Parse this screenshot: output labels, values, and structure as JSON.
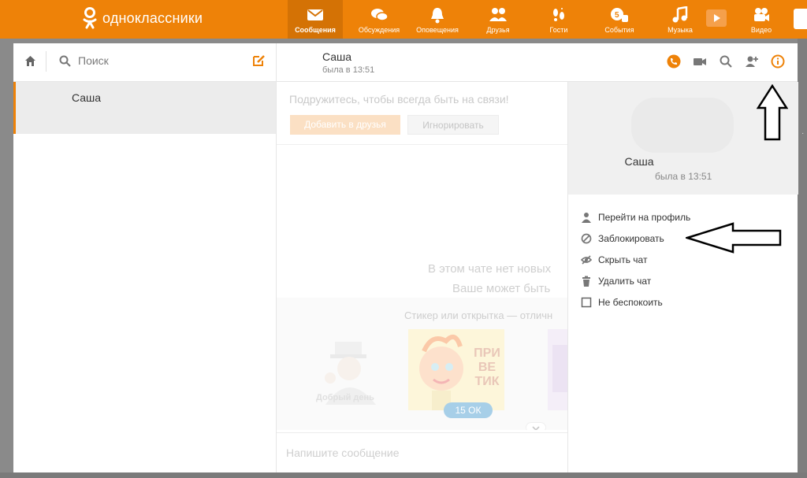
{
  "brand": {
    "name": "одноклассники"
  },
  "nav": [
    {
      "label": "Сообщения",
      "icon": "envelope-icon",
      "active": true
    },
    {
      "label": "Обсуждения",
      "icon": "chat-bubbles-icon",
      "active": false
    },
    {
      "label": "Оповещения",
      "icon": "bell-icon",
      "active": false
    },
    {
      "label": "Друзья",
      "icon": "friends-icon",
      "active": false
    },
    {
      "label": "Гости",
      "icon": "footprints-icon",
      "active": false
    },
    {
      "label": "События",
      "icon": "thumbs-up-icon",
      "active": false
    },
    {
      "label": "Музыка",
      "icon": "music-note-icon",
      "active": false
    },
    {
      "label": "Видео",
      "icon": "video-camera-icon",
      "active": false
    }
  ],
  "sidebar": {
    "search_placeholder": "Поиск",
    "chats": [
      {
        "name": "Саша"
      }
    ]
  },
  "chat": {
    "name": "Саша",
    "status": "была в 13:51",
    "befriend_prompt": "Подружитесь, чтобы всегда быть на связи!",
    "add_friend_label": "Добавить в друзья",
    "ignore_label": "Игнорировать",
    "empty_line1": "В этом чате нет новых",
    "empty_line2": "Ваше может быть",
    "sticker_hint": "Стикер или открытка — отличн",
    "sticker1_caption": "Добрый день",
    "sticker2_text": "ПРИ ВЕ ТИК",
    "sticker_price": "15 ОК",
    "input_placeholder": "Напишите сообщение"
  },
  "info_panel": {
    "name": "Саша",
    "status": "была в 13:51",
    "menu": [
      {
        "label": "Перейти на профиль",
        "icon": "person-icon"
      },
      {
        "label": "Заблокировать",
        "icon": "block-icon"
      },
      {
        "label": "Скрыть чат",
        "icon": "hidden-eye-icon"
      },
      {
        "label": "Удалить чат",
        "icon": "trash-icon"
      },
      {
        "label": "Не беспокоить",
        "icon": "checkbox-icon"
      }
    ]
  },
  "colors": {
    "accent": "#ee8208",
    "accent_dark": "#d47205"
  }
}
